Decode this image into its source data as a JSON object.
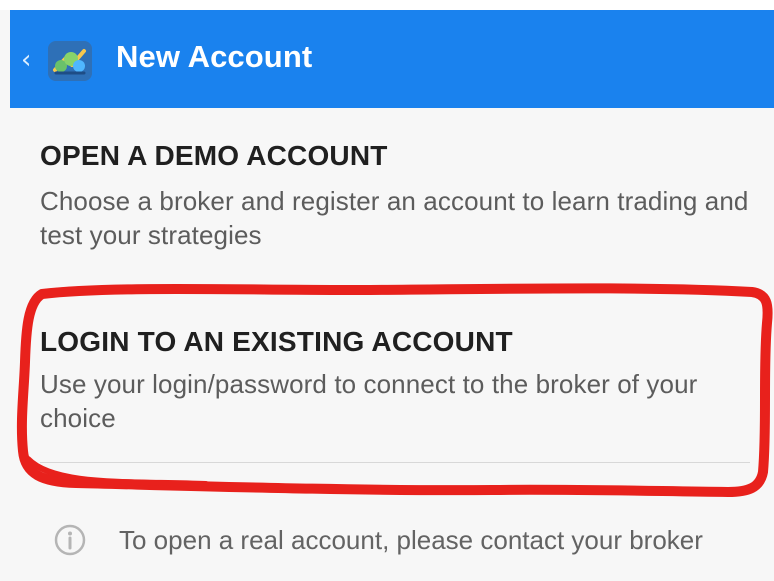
{
  "header": {
    "title": "New Account",
    "icons": {
      "back": "chevron-left-icon",
      "app": "metatrader-logo-icon"
    }
  },
  "options": [
    {
      "heading": "OPEN A DEMO ACCOUNT",
      "description": "Choose a broker and register an account to learn trading and test your strategies"
    },
    {
      "heading": "LOGIN TO AN EXISTING ACCOUNT",
      "description": "Use your login/password to connect to the broker of your choice"
    }
  ],
  "info": {
    "icon": "info-circle-icon",
    "text": "To open a real account, please contact your broker"
  },
  "colors": {
    "appbar": "#1a82ee",
    "annotation": "#e8211c"
  }
}
